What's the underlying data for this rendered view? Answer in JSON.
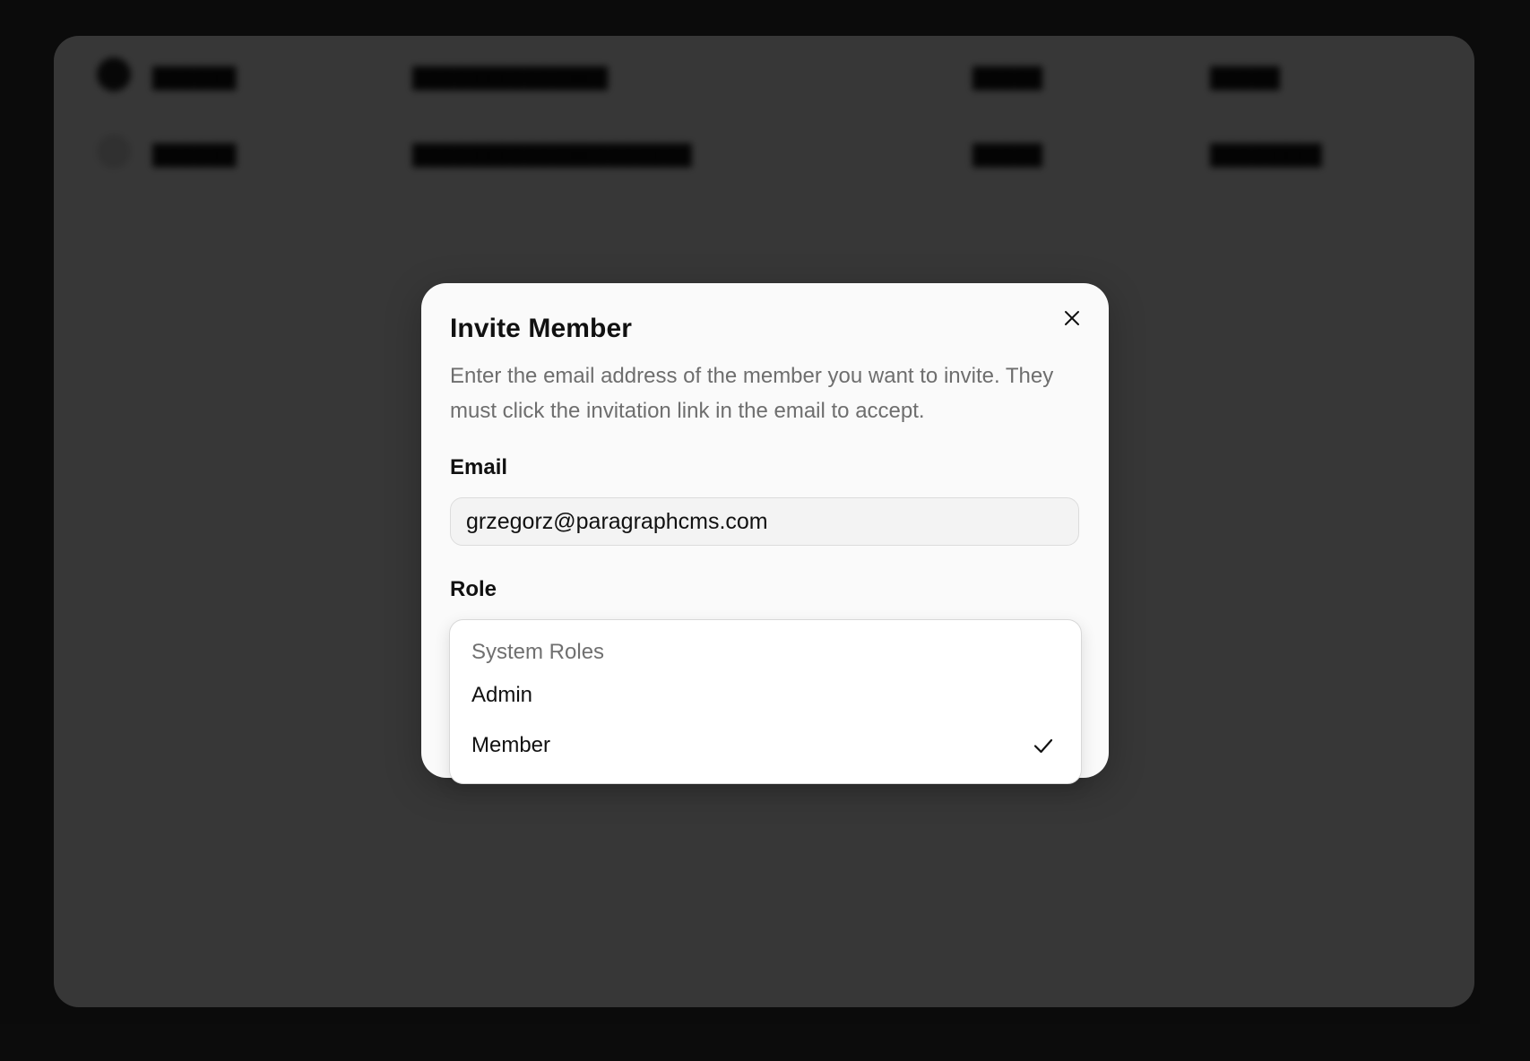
{
  "background": {
    "rows": [
      {
        "name": "██████",
        "email": "██████████████",
        "col3": "█████",
        "col4": "█████"
      },
      {
        "name": "██████",
        "email": "████████████████████",
        "col3": "█████",
        "col4": "████████"
      }
    ]
  },
  "dialog": {
    "title": "Invite Member",
    "description": "Enter the email address of the member you want to invite. They must click the invitation link in the email to accept.",
    "close_icon": "close-icon",
    "email": {
      "label": "Email",
      "value": "grzegorz@paragraphcms.com"
    },
    "role": {
      "label": "Role",
      "group_label": "System Roles",
      "options": [
        {
          "label": "Admin",
          "selected": false
        },
        {
          "label": "Member",
          "selected": true
        }
      ],
      "selected_icon": "check-icon"
    }
  },
  "colors": {
    "overlay": "#353535",
    "surface": "#fafafa",
    "text": "#111111",
    "muted": "#6e6e6e"
  }
}
